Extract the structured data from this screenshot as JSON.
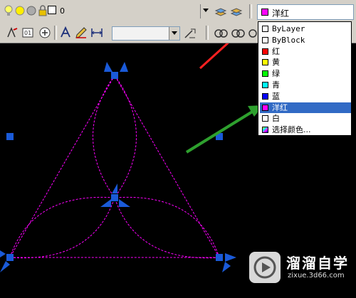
{
  "toolbar_top": {
    "layer_value": "0",
    "color_value": "洋红",
    "color_swatch": "#ff00ff"
  },
  "color_dropdown": {
    "items": [
      {
        "label": "ByLayer",
        "swatch": "#ffffff",
        "selected": false
      },
      {
        "label": "ByBlock",
        "swatch": "#ffffff",
        "selected": false
      },
      {
        "label": "红",
        "swatch": "#ff0000",
        "selected": false
      },
      {
        "label": "黄",
        "swatch": "#ffff00",
        "selected": false
      },
      {
        "label": "绿",
        "swatch": "#00ff00",
        "selected": false
      },
      {
        "label": "青",
        "swatch": "#00ffff",
        "selected": false
      },
      {
        "label": "蓝",
        "swatch": "#0000ff",
        "selected": false
      },
      {
        "label": "洋红",
        "swatch": "#ff00ff",
        "selected": true
      },
      {
        "label": "白",
        "swatch": "#ffffff",
        "selected": false
      },
      {
        "label": "选择颜色...",
        "swatch": "#c0c0c0",
        "selected": false
      }
    ]
  },
  "watermark": {
    "name": "溜溜自学",
    "url": "zixue.3d66.com"
  },
  "colors": {
    "canvas_bg": "#000000",
    "grip": "#1a5ad8",
    "curve": "#ff00ff",
    "red_arrow": "#ff2020",
    "green_arrow": "#2ea02e"
  }
}
